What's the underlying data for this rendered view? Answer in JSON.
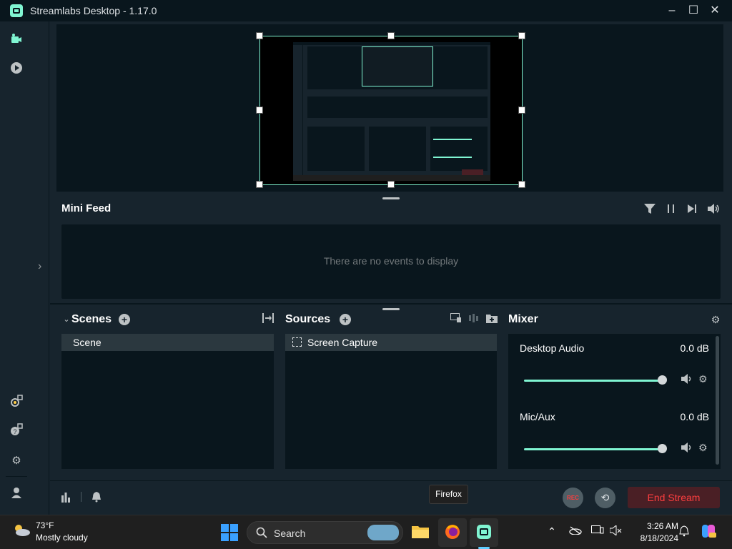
{
  "window": {
    "title": "Streamlabs Desktop - 1.17.0"
  },
  "mini_feed": {
    "title": "Mini Feed",
    "empty_text": "There are no events to display"
  },
  "scenes": {
    "title": "Scenes",
    "items": [
      "Scene"
    ]
  },
  "sources": {
    "title": "Sources",
    "items": [
      "Screen Capture"
    ]
  },
  "mixer": {
    "title": "Mixer",
    "channels": [
      {
        "name": "Desktop Audio",
        "level": "0.0 dB",
        "volume_fraction": 1.0
      },
      {
        "name": "Mic/Aux",
        "level": "0.0 dB",
        "volume_fraction": 1.0
      }
    ]
  },
  "footer": {
    "rec_label": "REC",
    "end_stream_label": "End Stream",
    "tooltip": "Firefox"
  },
  "taskbar": {
    "weather_temp": "73°F",
    "weather_desc": "Mostly cloudy",
    "search_label": "Search",
    "time": "3:26 AM",
    "date": "8/18/2024"
  },
  "colors": {
    "accent": "#80f5d2",
    "background": "#17242d",
    "panel": "#09161d",
    "danger": "#fc3e3f"
  }
}
